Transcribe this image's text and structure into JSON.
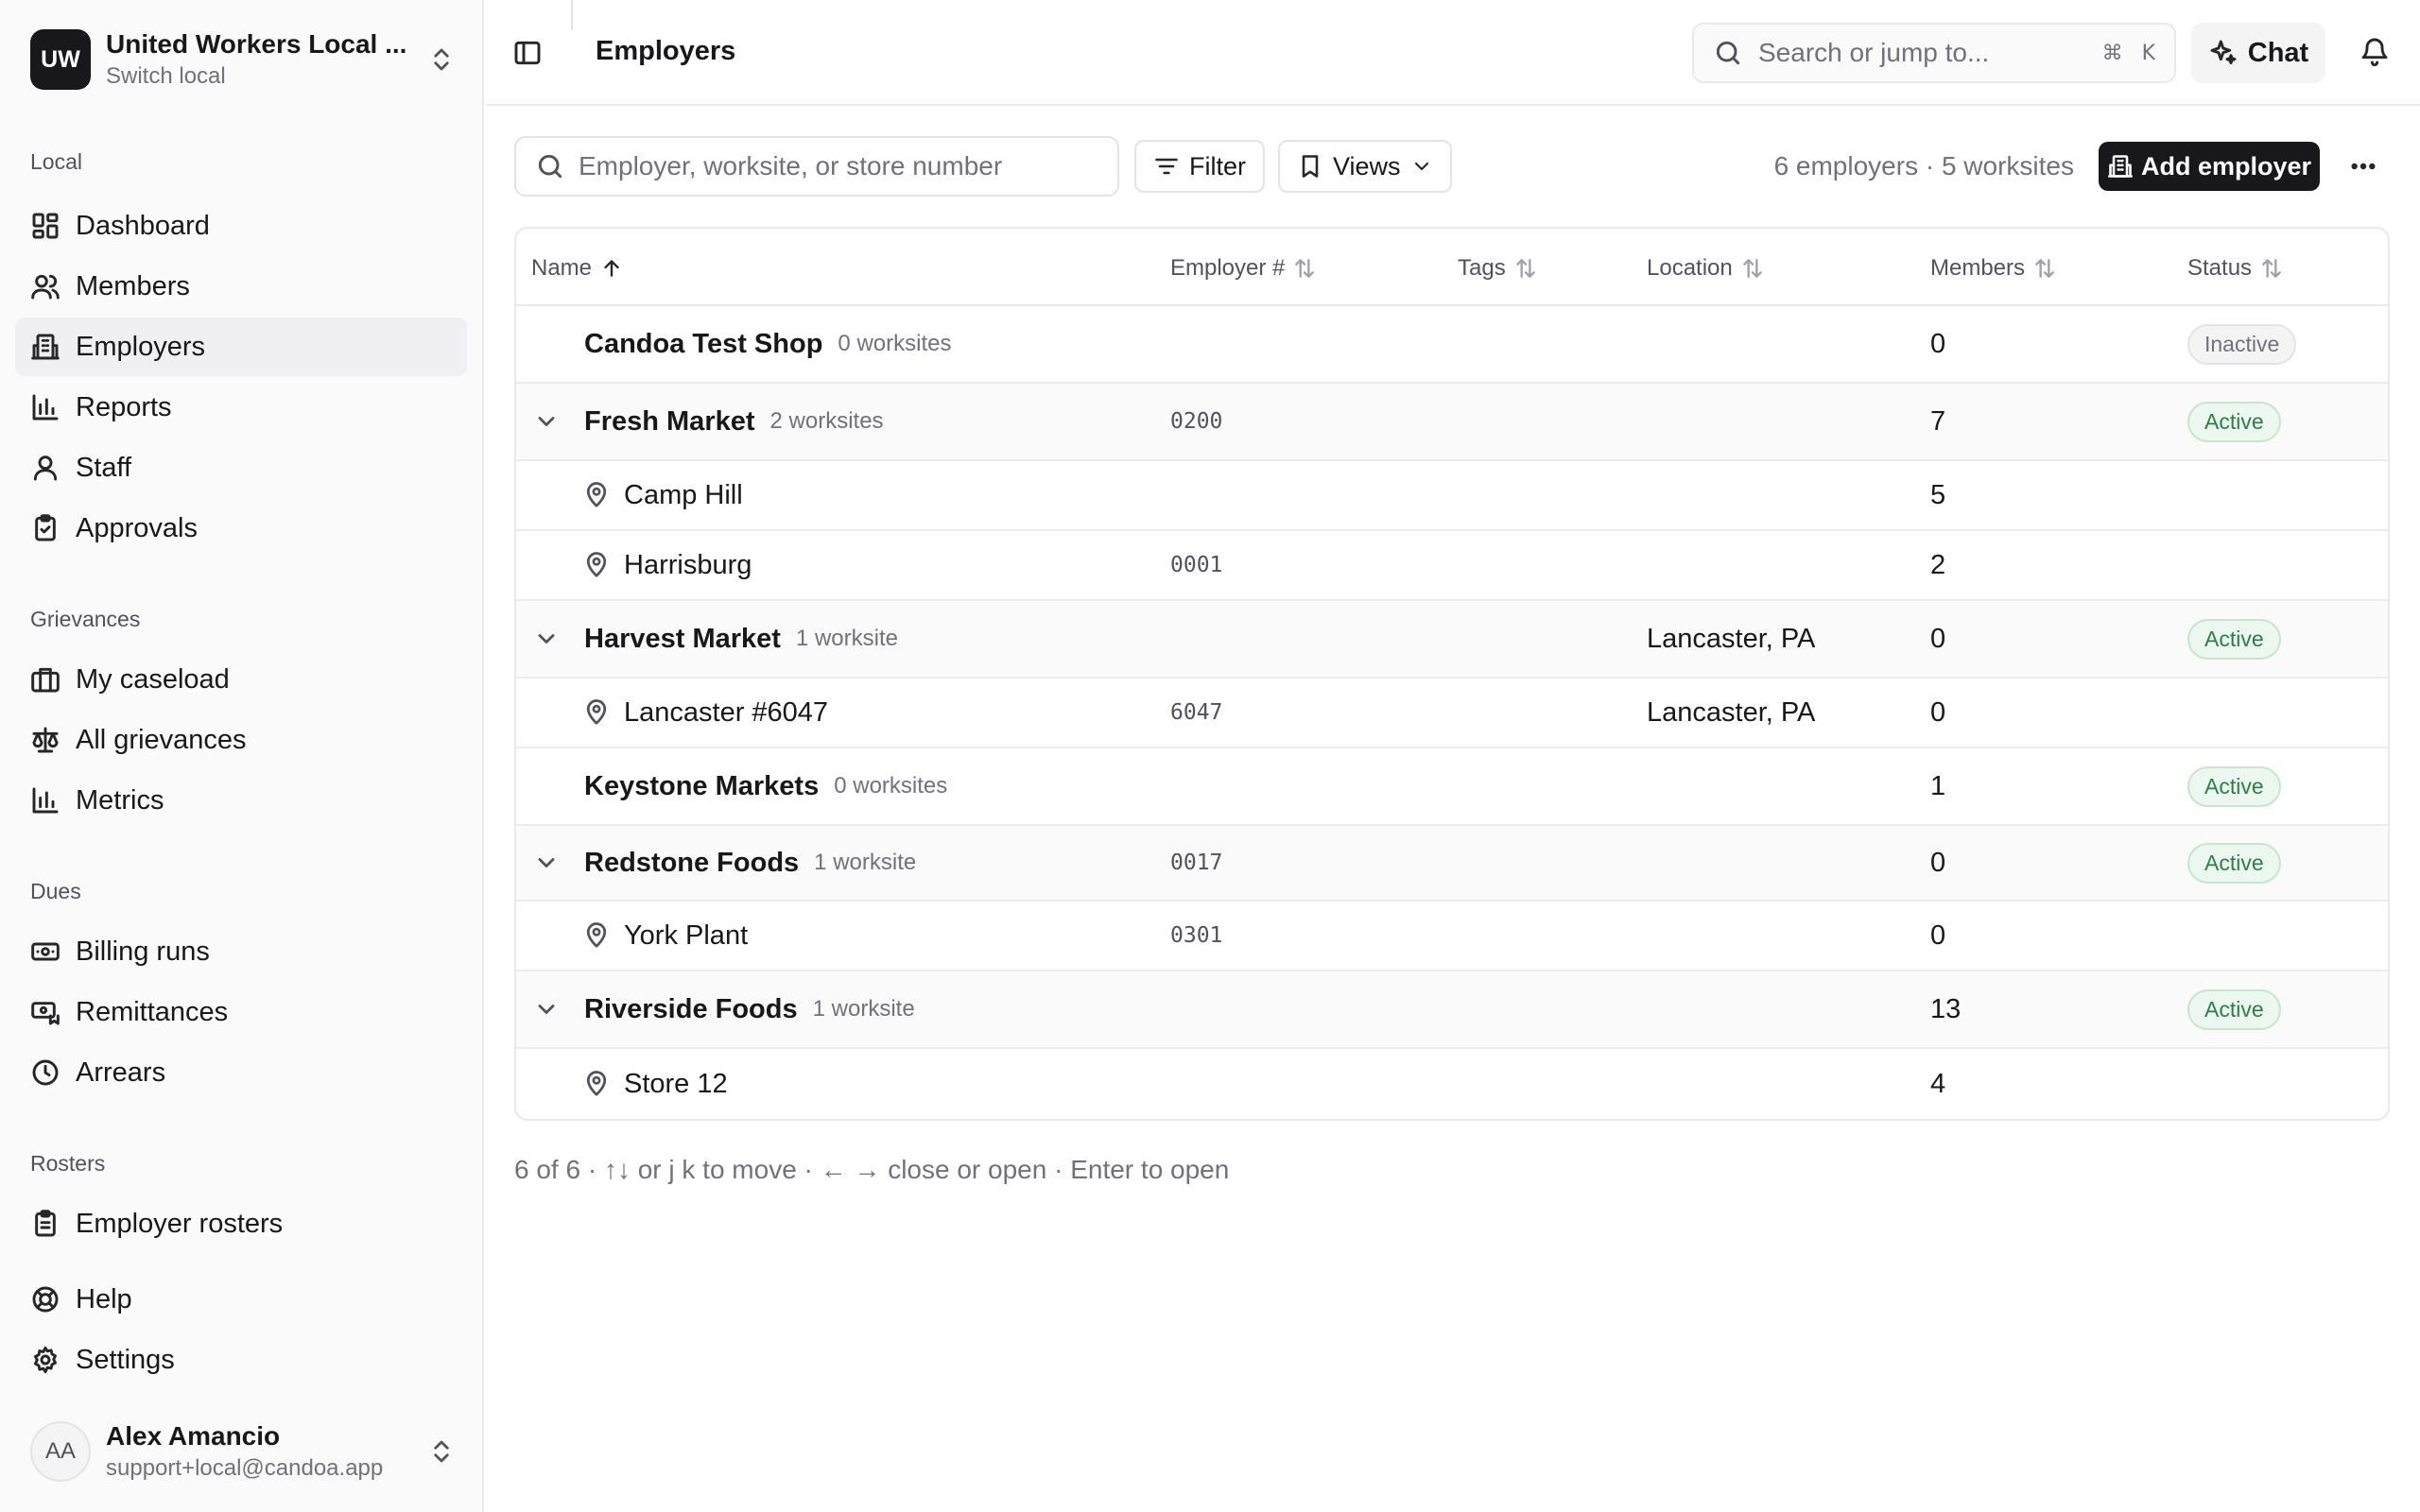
{
  "org": {
    "initials": "UW",
    "name": "United Workers Local ...",
    "sub": "Switch local"
  },
  "sidebar": {
    "sections": [
      {
        "label": "Local",
        "items": [
          {
            "label": "Dashboard"
          },
          {
            "label": "Members"
          },
          {
            "label": "Employers"
          },
          {
            "label": "Reports"
          },
          {
            "label": "Staff"
          },
          {
            "label": "Approvals"
          }
        ]
      },
      {
        "label": "Grievances",
        "items": [
          {
            "label": "My caseload"
          },
          {
            "label": "All grievances"
          },
          {
            "label": "Metrics"
          }
        ]
      },
      {
        "label": "Dues",
        "items": [
          {
            "label": "Billing runs"
          },
          {
            "label": "Remittances"
          },
          {
            "label": "Arrears"
          }
        ]
      },
      {
        "label": "Rosters",
        "items": [
          {
            "label": "Employer rosters"
          }
        ]
      }
    ],
    "bottom": [
      {
        "label": "Help"
      },
      {
        "label": "Settings"
      }
    ],
    "active": "Employers"
  },
  "user": {
    "initials": "AA",
    "name": "Alex Amancio",
    "email": "support+local@candoa.app"
  },
  "header": {
    "title": "Employers",
    "search_placeholder": "Search or jump to...",
    "shortcut_cmd": "⌘",
    "shortcut_key": "K",
    "chat_label": "Chat"
  },
  "toolbar": {
    "search_placeholder": "Employer, worksite, or store number",
    "filter_label": "Filter",
    "views_label": "Views",
    "counts": "6 employers · 5 worksites",
    "add_label": "Add employer"
  },
  "table": {
    "columns": [
      {
        "label": "Name",
        "sort": "asc"
      },
      {
        "label": "Employer #",
        "sort": "none"
      },
      {
        "label": "Tags",
        "sort": "none"
      },
      {
        "label": "Location",
        "sort": "none"
      },
      {
        "label": "Members",
        "sort": "none"
      },
      {
        "label": "Status",
        "sort": "none"
      }
    ],
    "rows": [
      {
        "type": "employer",
        "expandable": false,
        "name": "Candoa Test Shop",
        "worksites": "0 worksites",
        "number": "",
        "location": "",
        "members": "0",
        "status": "Inactive"
      },
      {
        "type": "employer",
        "expandable": true,
        "name": "Fresh Market",
        "worksites": "2 worksites",
        "number": "0200",
        "location": "",
        "members": "7",
        "status": "Active"
      },
      {
        "type": "site",
        "name": "Camp Hill",
        "number": "",
        "location": "",
        "members": "5"
      },
      {
        "type": "site",
        "name": "Harrisburg",
        "number": "0001",
        "location": "",
        "members": "2"
      },
      {
        "type": "employer",
        "expandable": true,
        "name": "Harvest Market",
        "worksites": "1 worksite",
        "number": "",
        "location": "Lancaster, PA",
        "members": "0",
        "status": "Active"
      },
      {
        "type": "site",
        "name": "Lancaster #6047",
        "number": "6047",
        "location": "Lancaster, PA",
        "members": "0"
      },
      {
        "type": "employer",
        "expandable": false,
        "name": "Keystone Markets",
        "worksites": "0 worksites",
        "number": "",
        "location": "",
        "members": "1",
        "status": "Active"
      },
      {
        "type": "employer",
        "expandable": true,
        "name": "Redstone Foods",
        "worksites": "1 worksite",
        "number": "0017",
        "location": "",
        "members": "0",
        "status": "Active"
      },
      {
        "type": "site",
        "name": "York Plant",
        "number": "0301",
        "location": "",
        "members": "0"
      },
      {
        "type": "employer",
        "expandable": true,
        "name": "Riverside Foods",
        "worksites": "1 worksite",
        "number": "",
        "location": "",
        "members": "13",
        "status": "Active"
      },
      {
        "type": "site",
        "name": "Store 12",
        "number": "",
        "location": "",
        "members": "4"
      }
    ]
  },
  "footer_hint": "6 of 6 · ↑↓ or j k to move · ← → close or open · Enter to open",
  "colors": {
    "active_badge": "#2f7d4a",
    "primary_button": "#18181b",
    "sidebar_bg": "#fafafa"
  }
}
